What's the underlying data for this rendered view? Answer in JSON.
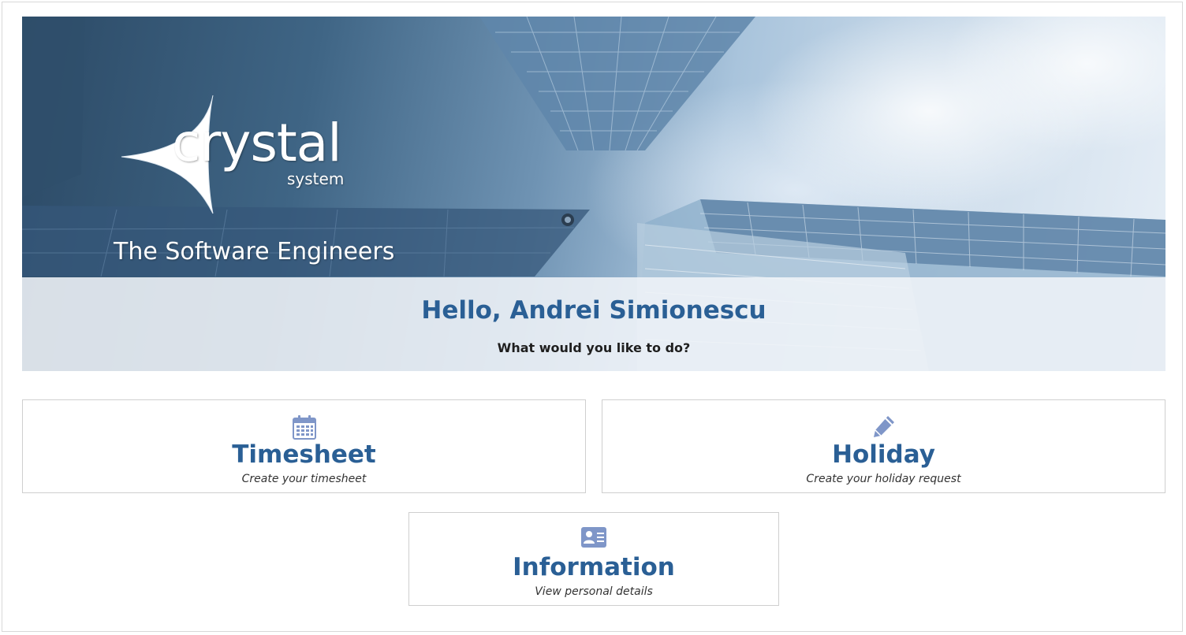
{
  "banner": {
    "logo_word": "crystal",
    "logo_sub": "system",
    "tagline": "The Software Engineers"
  },
  "welcome": {
    "greeting": "Hello, Andrei Simionescu",
    "prompt": "What would you like to do?"
  },
  "cards": [
    {
      "icon": "calendar-icon",
      "title": "Timesheet",
      "subtitle": "Create your timesheet"
    },
    {
      "icon": "pencil-icon",
      "title": "Holiday",
      "subtitle": "Create your holiday request"
    },
    {
      "icon": "id-card-icon",
      "title": "Information",
      "subtitle": "View personal details"
    }
  ],
  "colors": {
    "title_blue": "#2a5f95",
    "icon_blue": "#7f96c8"
  }
}
